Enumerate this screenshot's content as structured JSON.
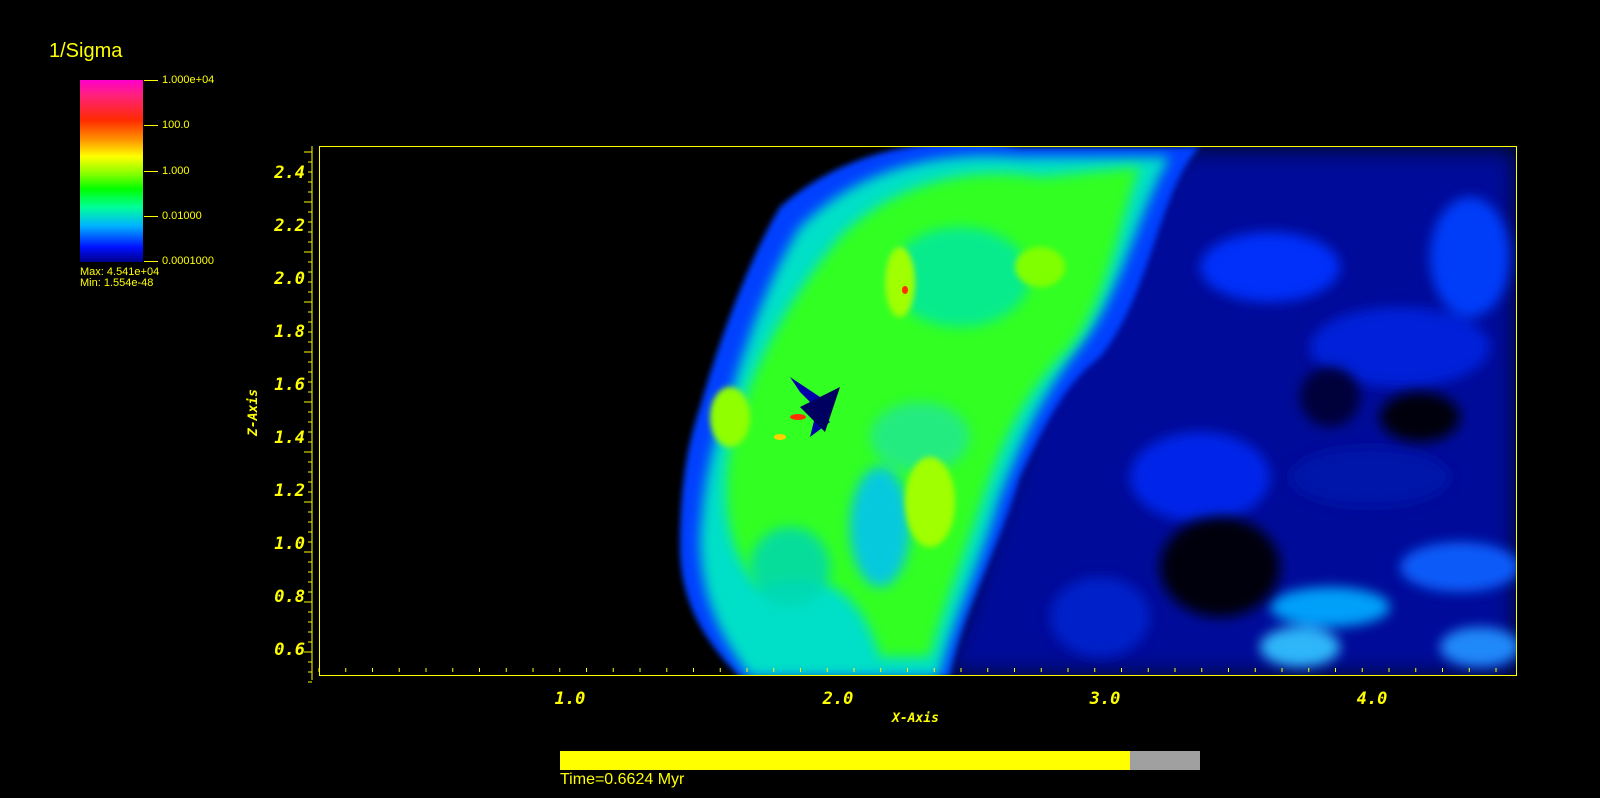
{
  "legend": {
    "title": "1/Sigma",
    "ticks": [
      "1.000e+04",
      "100.0",
      "1.000",
      "0.01000",
      "0.0001000"
    ],
    "max_label": "Max:  4.541e+04",
    "min_label": "Min:  1.554e-48"
  },
  "plot": {
    "x_axis_title": "X-Axis",
    "y_axis_title": "Z-Axis",
    "y_ticks": [
      "2.4",
      "2.2",
      "2.0",
      "1.8",
      "1.6",
      "1.4",
      "1.2",
      "1.0",
      "0.8",
      "0.6"
    ],
    "x_ticks": [
      "1.0",
      "2.0",
      "3.0",
      "4.0"
    ],
    "colors": {
      "axis": "#ffff00",
      "background": "#000000"
    }
  },
  "time_slider": {
    "label": "Time=0.6624 Myr",
    "progress": 0.89
  }
}
